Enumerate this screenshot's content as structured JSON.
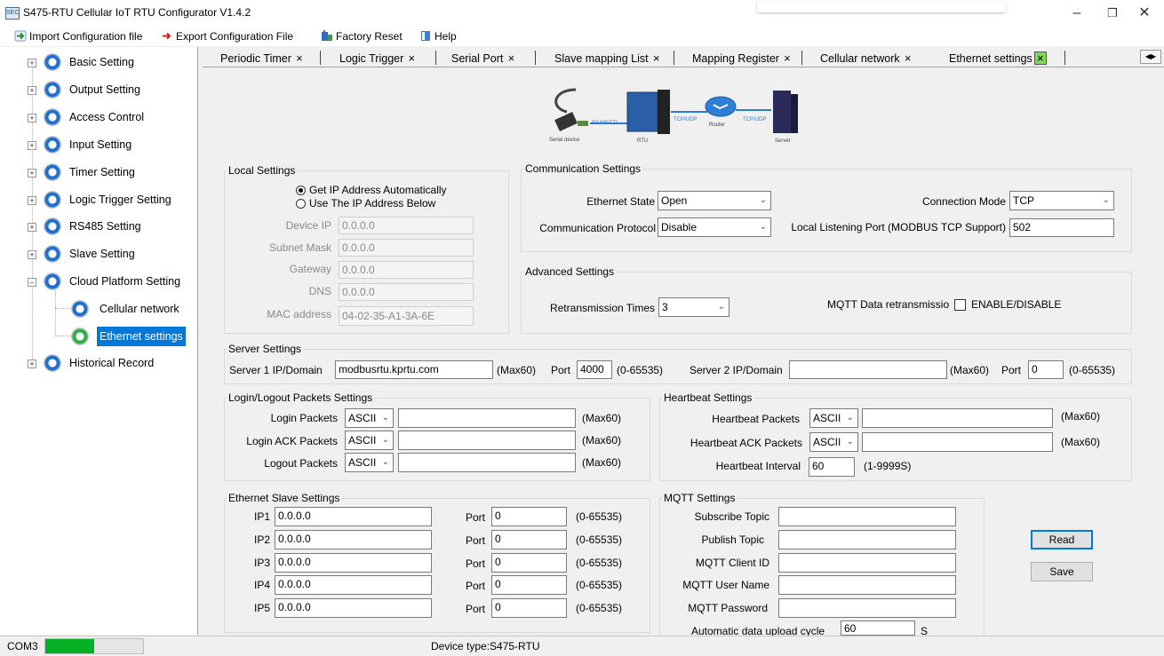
{
  "window": {
    "title": "S475-RTU Cellular IoT RTU Configurator V1.4.2",
    "app_icon_text": "SEC"
  },
  "menu": {
    "import": "Import Configuration file",
    "export": "Export Configuration File",
    "factory_reset": "Factory Reset",
    "help": "Help"
  },
  "sidebar": {
    "items": [
      {
        "label": "Basic Setting"
      },
      {
        "label": "Output Setting"
      },
      {
        "label": "Access Control"
      },
      {
        "label": "Input Setting"
      },
      {
        "label": "Timer Setting"
      },
      {
        "label": "Logic Trigger Setting"
      },
      {
        "label": "RS485 Setting"
      },
      {
        "label": "Slave Setting"
      },
      {
        "label": "Cloud Platform Setting"
      },
      {
        "label": "Cellular network"
      },
      {
        "label": "Ethernet settings"
      },
      {
        "label": "Historical Record"
      }
    ]
  },
  "tabs": [
    {
      "label": "Periodic Timer",
      "close": "×"
    },
    {
      "label": "Logic Trigger",
      "close": "×"
    },
    {
      "label": "Serial Port",
      "close": "×"
    },
    {
      "label": "Slave mapping List",
      "close": "×"
    },
    {
      "label": "Mapping Register",
      "close": "×"
    },
    {
      "label": "Cellular network",
      "close": "×"
    },
    {
      "label": "Ethernet settings",
      "close": "×"
    }
  ],
  "diagram": {
    "serial_device": "Serial device",
    "rs485": "RS485/TTL",
    "rtu": "RTU",
    "tcpudp1": "TCP/UDP",
    "router": "Router",
    "tcpudp2": "TCP/UDP",
    "server": "Server"
  },
  "local": {
    "title": "Local Settings",
    "radio_auto": "Get IP Address Automatically",
    "radio_manual": "Use The IP Address Below",
    "device_ip_label": "Device IP",
    "device_ip": "0.0.0.0",
    "subnet_label": "Subnet Mask",
    "subnet": "0.0.0.0",
    "gateway_label": "Gateway",
    "gateway": "0.0.0.0",
    "dns_label": "DNS",
    "dns": "0.0.0.0",
    "mac_label": "MAC address",
    "mac": "04-02-35-A1-3A-6E"
  },
  "comm": {
    "title": "Communication Settings",
    "eth_state_label": "Ethernet State",
    "eth_state": "Open",
    "conn_mode_label": "Connection Mode",
    "conn_mode": "TCP",
    "protocol_label": "Communication Protocol",
    "protocol": "Disable",
    "listen_label": "Local Listening Port (MODBUS TCP Support)",
    "listen_port": "502"
  },
  "advanced": {
    "title": "Advanced Settings",
    "retrans_label": "Retransmission Times",
    "retrans": "3",
    "mqtt_label": "MQTT Data retransmissio",
    "enable_label": "ENABLE/DISABLE"
  },
  "server": {
    "title": "Server Settings",
    "s1_label": "Server 1 IP/Domain",
    "s1": "modbusrtu.kprtu.com",
    "s1_max": "(Max60)",
    "port_label": "Port",
    "s1_port": "4000",
    "port_range": "(0-65535)",
    "s2_label": "Server 2 IP/Domain",
    "s2": "",
    "s2_max": "(Max60)",
    "s2_port": "0",
    "port_range2": "(0-65535)"
  },
  "login": {
    "title": "Login/Logout Packets Settings",
    "rows": [
      {
        "label": "Login Packets",
        "fmt": "ASCII",
        "value": "",
        "max": "(Max60)"
      },
      {
        "label": "Login ACK Packets",
        "fmt": "ASCII",
        "value": "",
        "max": "(Max60)"
      },
      {
        "label": "Logout Packets",
        "fmt": "ASCII",
        "value": "",
        "max": "(Max60)"
      }
    ]
  },
  "heartbeat": {
    "title": "Heartbeat Settings",
    "rows": [
      {
        "label": "Heartbeat Packets",
        "fmt": "ASCII",
        "value": "",
        "max": "(Max60)"
      },
      {
        "label": "Heartbeat ACK Packets",
        "fmt": "ASCII",
        "value": "",
        "max": "(Max60)"
      }
    ],
    "interval_label": "Heartbeat Interval",
    "interval": "60",
    "interval_range": "(1-9999S)"
  },
  "slave": {
    "title": "Ethernet Slave Settings",
    "rows": [
      {
        "label": "IP1",
        "ip": "0.0.0.0",
        "port_label": "Port",
        "port": "0",
        "range": "(0-65535)"
      },
      {
        "label": "IP2",
        "ip": "0.0.0.0",
        "port_label": "Port",
        "port": "0",
        "range": "(0-65535)"
      },
      {
        "label": "IP3",
        "ip": "0.0.0.0",
        "port_label": "Port",
        "port": "0",
        "range": "(0-65535)"
      },
      {
        "label": "IP4",
        "ip": "0.0.0.0",
        "port_label": "Port",
        "port": "0",
        "range": "(0-65535)"
      },
      {
        "label": "IP5",
        "ip": "0.0.0.0",
        "port_label": "Port",
        "port": "0",
        "range": "(0-65535)"
      }
    ]
  },
  "mqtt": {
    "title": "MQTT Settings",
    "rows": [
      {
        "label": "Subscribe Topic",
        "value": ""
      },
      {
        "label": "Publish Topic",
        "value": ""
      },
      {
        "label": "MQTT Client ID",
        "value": ""
      },
      {
        "label": "MQTT User Name",
        "value": ""
      },
      {
        "label": "MQTT Password",
        "value": ""
      }
    ],
    "cycle_label": "Automatic data upload cycle",
    "cycle": "60",
    "cycle_unit": "S"
  },
  "buttons": {
    "read": "Read",
    "save": "Save"
  },
  "status": {
    "port": "COM3",
    "device_type": "Device type:S475-RTU",
    "progress_fraction": 0.5
  }
}
